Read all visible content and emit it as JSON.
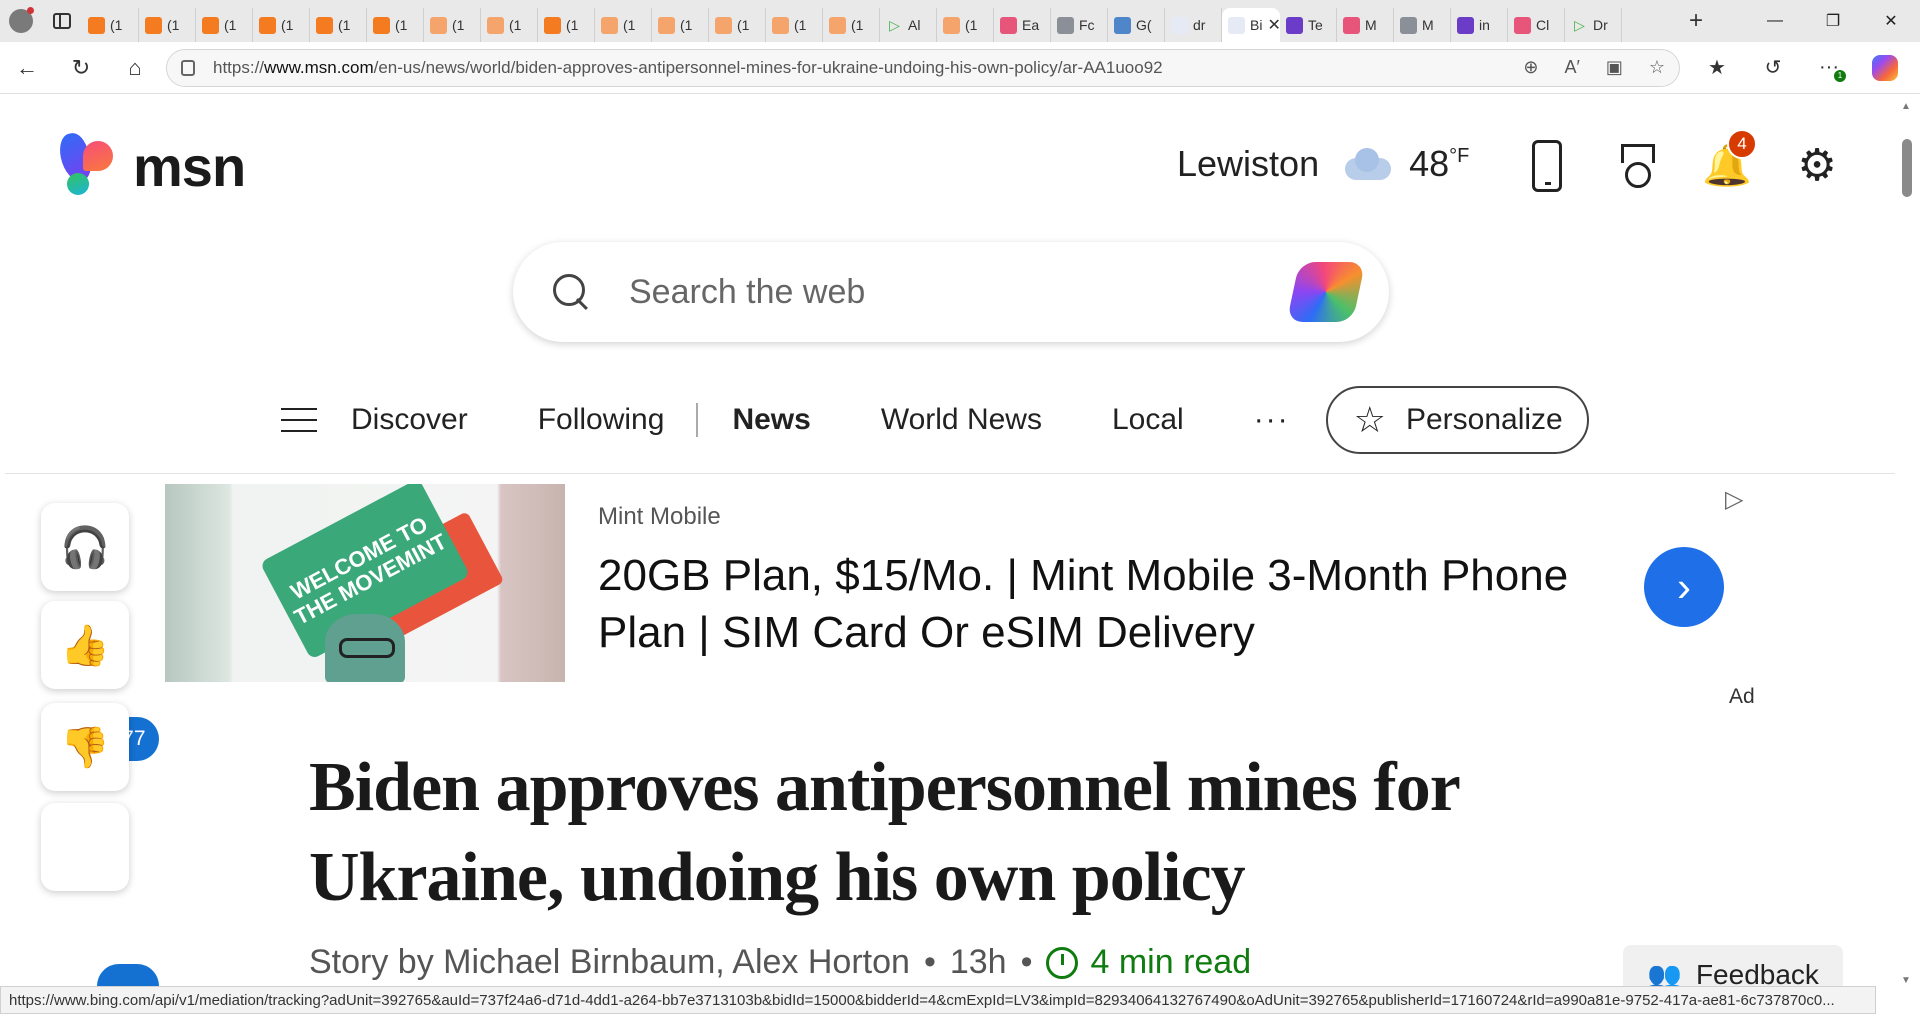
{
  "browser": {
    "tabs": [
      {
        "icon": "orange",
        "label": "(1"
      },
      {
        "icon": "orange",
        "label": "(1"
      },
      {
        "icon": "orange",
        "label": "(1"
      },
      {
        "icon": "orange",
        "label": "(1"
      },
      {
        "icon": "orange",
        "label": "(1"
      },
      {
        "icon": "orange",
        "label": "(1"
      },
      {
        "icon": "lightorange",
        "label": "(1"
      },
      {
        "icon": "lightorange",
        "label": "(1"
      },
      {
        "icon": "orange",
        "label": "(1"
      },
      {
        "icon": "lightorange",
        "label": "(1"
      },
      {
        "icon": "lightorange",
        "label": "(1"
      },
      {
        "icon": "lightorange",
        "label": "(1"
      },
      {
        "icon": "lightorange",
        "label": "(1"
      },
      {
        "icon": "lightorange",
        "label": "(1"
      },
      {
        "icon": "green",
        "label": "Al"
      },
      {
        "icon": "lightorange",
        "label": "(1"
      },
      {
        "icon": "pink",
        "label": "Ea"
      },
      {
        "icon": "gray",
        "label": "Fc"
      },
      {
        "icon": "blue",
        "label": "G("
      },
      {
        "icon": "msn",
        "label": "dr"
      },
      {
        "icon": "active",
        "label": "Bi"
      },
      {
        "icon": "purple",
        "label": "Te"
      },
      {
        "icon": "pink",
        "label": "M"
      },
      {
        "icon": "gray",
        "label": "M"
      },
      {
        "icon": "purple",
        "label": "in"
      },
      {
        "icon": "pink",
        "label": "Cl"
      },
      {
        "icon": "green",
        "label": "Dr"
      }
    ],
    "url_prefix": "https://",
    "url_host": "www.msn.com",
    "url_path": "/en-us/news/world/biden-approves-antipersonnel-mines-for-ukraine-undoing-his-own-policy/ar-AA1uoo92",
    "extension_badge": "1"
  },
  "header": {
    "logo_text": "msn",
    "location": "Lewiston",
    "temperature": "48",
    "temp_unit": "°F",
    "notification_count": "4"
  },
  "search": {
    "placeholder": "Search the web"
  },
  "nav": {
    "items": [
      "Discover",
      "Following",
      "News",
      "World News",
      "Local"
    ],
    "more": "···",
    "personalize": "Personalize"
  },
  "ad": {
    "card_text": "WELCOME TO THE MOVEMINT",
    "brand": "Mint Mobile",
    "title": "20GB Plan, $15/Mo. | Mint Mobile 3-Month Phone Plan | SIM Card Or eSIM Delivery",
    "label": "Ad"
  },
  "rail": {
    "like_count": "177"
  },
  "article": {
    "headline": "Biden approves antipersonnel mines for Ukraine, undoing his own policy",
    "byline": "Story by Michael Birnbaum, Alex Horton",
    "age": "13h",
    "read_time": "4 min read",
    "feedback": "Feedback"
  },
  "status": {
    "link": "https://www.bing.com/api/v1/mediation/tracking?adUnit=392765&auId=737f24a6-d71d-4dd1-a264-bb7e3713103b&bidId=15000&bidderId=4&cmExpId=LV3&impId=82934064132767490&oAdUnit=392765&publisherId=17160724&rId=a990a81e-9752-417a-ae81-6c737870c0..."
  }
}
